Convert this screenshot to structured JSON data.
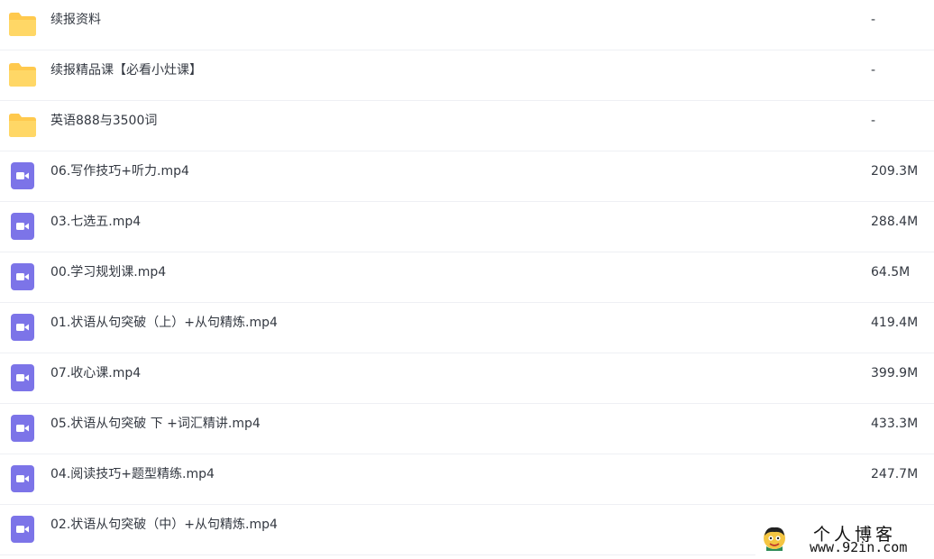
{
  "files": [
    {
      "name": "续报资料",
      "size": "-",
      "type": "folder"
    },
    {
      "name": "续报精品课【必看小灶课】",
      "size": "-",
      "type": "folder"
    },
    {
      "name": "英语888与3500词",
      "size": "-",
      "type": "folder"
    },
    {
      "name": "06.写作技巧+听力.mp4",
      "size": "209.3M",
      "type": "video"
    },
    {
      "name": "03.七选五.mp4",
      "size": "288.4M",
      "type": "video"
    },
    {
      "name": "00.学习规划课.mp4",
      "size": "64.5M",
      "type": "video"
    },
    {
      "name": "01.状语从句突破（上）+从句精炼.mp4",
      "size": "419.4M",
      "type": "video"
    },
    {
      "name": "07.收心课.mp4",
      "size": "399.9M",
      "type": "video"
    },
    {
      "name": "05.状语从句突破 下 +词汇精讲.mp4",
      "size": "433.3M",
      "type": "video"
    },
    {
      "name": "04.阅读技巧+题型精练.mp4",
      "size": "247.7M",
      "type": "video"
    },
    {
      "name": "02.状语从句突破（中）+从句精炼.mp4",
      "size": "",
      "type": "video"
    }
  ],
  "icons": {
    "folder": "folder-icon",
    "video": "video-file-icon"
  },
  "colors": {
    "folder": "#ffc94d",
    "video": "#7c74e8",
    "text": "#333841",
    "divider": "#eef0f4"
  },
  "watermark": {
    "title": "个人博客",
    "url": "www.92in.com"
  }
}
